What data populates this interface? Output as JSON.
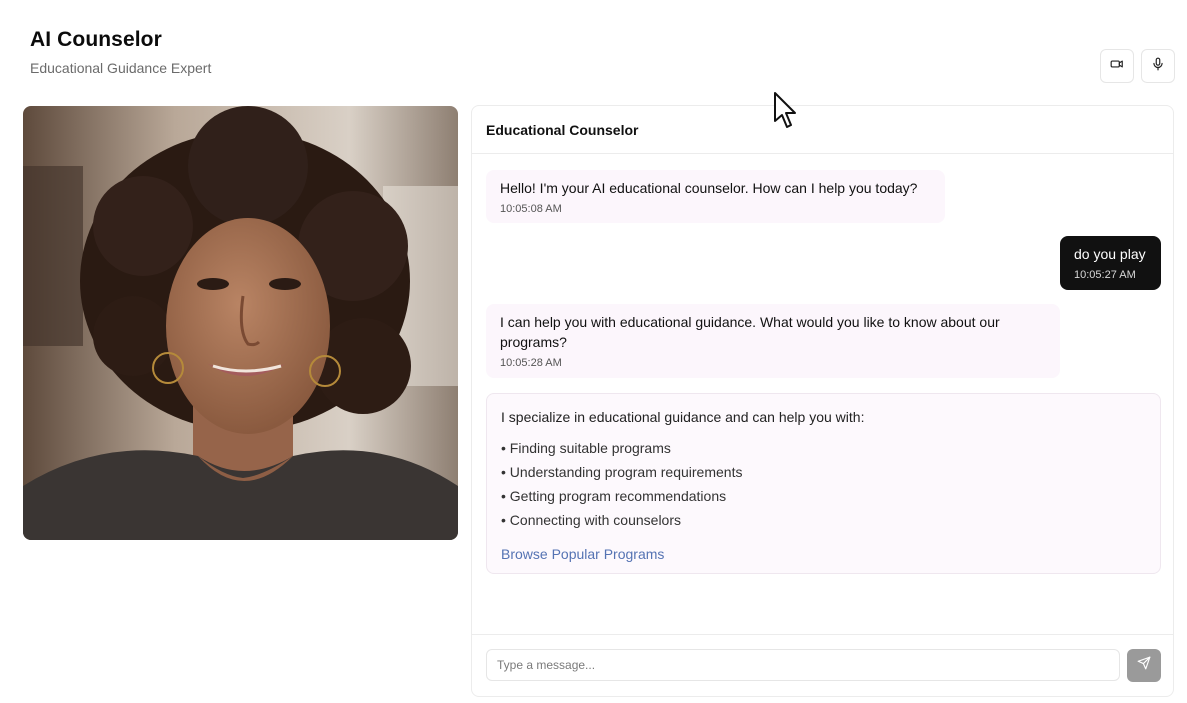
{
  "header": {
    "title": "AI Counselor",
    "subtitle": "Educational Guidance Expert"
  },
  "toolbar": {
    "video_icon": "video-camera-icon",
    "mic_icon": "microphone-icon"
  },
  "chat": {
    "title": "Educational Counselor",
    "messages": [
      {
        "role": "bot",
        "text": "Hello! I'm your AI educational counselor. How can I help you today?",
        "time": "10:05:08 AM"
      },
      {
        "role": "user",
        "text": "do you play",
        "time": "10:05:27 AM"
      },
      {
        "role": "bot",
        "text": "I can help you with educational guidance. What would you like to know about our programs?",
        "time": "10:05:28 AM"
      }
    ],
    "card": {
      "intro": "I specialize in educational guidance and can help you with:",
      "items": [
        "• Finding suitable programs",
        "• Understanding program requirements",
        "• Getting program recommendations",
        "• Connecting with counselors"
      ],
      "link": "Browse Popular Programs"
    },
    "input": {
      "placeholder": "Type a message...",
      "value": ""
    },
    "send_icon": "send-icon"
  },
  "colors": {
    "bot_bubble": "#fcf6fc",
    "user_bubble": "#111111",
    "link": "#5573b3",
    "send_button": "#9a9a9a"
  }
}
